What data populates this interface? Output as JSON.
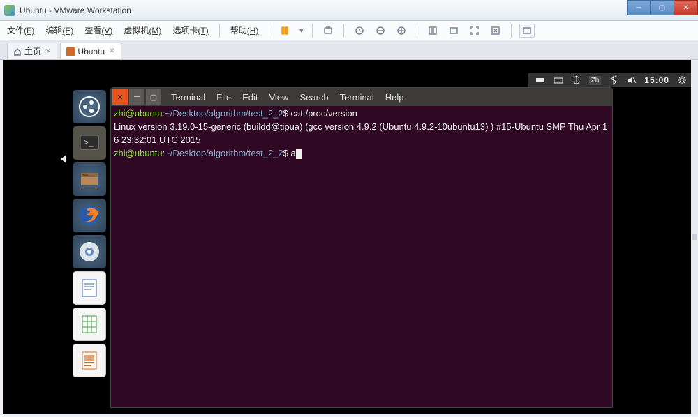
{
  "window": {
    "title": "Ubuntu - VMware Workstation"
  },
  "menu": {
    "file": "文件",
    "file_k": "(F)",
    "edit": "编辑",
    "edit_k": "(E)",
    "view": "查看",
    "view_k": "(V)",
    "vm": "虚拟机",
    "vm_k": "(M)",
    "tabs": "选项卡",
    "tabs_k": "(T)",
    "help": "帮助",
    "help_k": "(H)"
  },
  "tabs": {
    "home": "主页",
    "vm": "Ubuntu"
  },
  "panel": {
    "lang": "Zh",
    "time": "15:00"
  },
  "term_menu": {
    "terminal": "Terminal",
    "file": "File",
    "edit": "Edit",
    "view": "View",
    "search": "Search",
    "terminal2": "Terminal",
    "help": "Help"
  },
  "terminal": {
    "user1": "zhi@ubuntu",
    "path1": "~/Desktop/algorithm/test_2_2",
    "cmd1": "cat /proc/version",
    "out_l1": "Linux version 3.19.0-15-generic (buildd@tipua) (gcc version 4.9.2 (Ubuntu 4.9.2-10ubuntu13) ) #15-Ubuntu SMP Thu Apr 16 23:32:01 UTC 2015",
    "user2": "zhi@ubuntu",
    "path2": "~/Desktop/algorithm/test_2_2",
    "cmd2": "a"
  }
}
